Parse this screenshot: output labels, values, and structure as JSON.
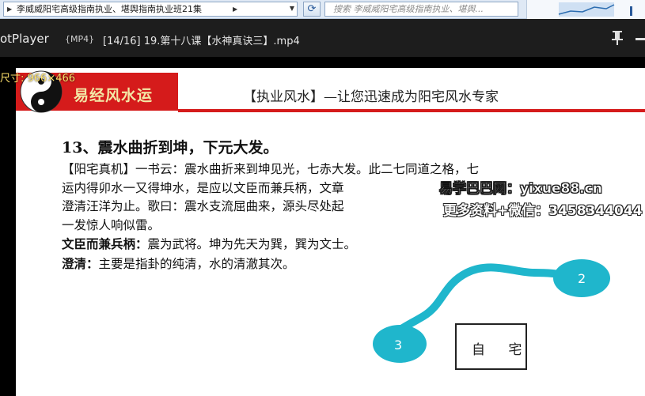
{
  "explorer": {
    "path_segments": [
      "李威威阳宅高级指南执业、堪舆指南执业班21集"
    ],
    "search_placeholder": "搜索 李威威阳宅高级指南执业、堪舆..."
  },
  "player": {
    "app_name": "otPlayer",
    "format": "{MP4}",
    "file_title": "[14/16] 19.第十八课【水神真诀三】.mp4"
  },
  "overlay": {
    "resolution_label": "尺寸: 966×466"
  },
  "slide": {
    "brand": "易经风水运",
    "tagline": "【执业风水】—让您迅速成为阳宅风水专家",
    "heading": "13、震水曲折到坤，下元大发。",
    "lines": [
      "【阳宅真机】一书云：震水曲折来到坤见光，七赤大发。此二七同道之格，七",
      "运内得卯水一又得坤水，是应以文臣而兼兵柄，文章",
      "澄清汪洋为止。歌曰：震水支流屈曲来，源头尽处起",
      "一发惊人响似雷。"
    ],
    "term1_label": "文臣而兼兵柄：",
    "term1_text": "震为武将。坤为先天为巽，巽为文士。",
    "term2_label": "澄清：",
    "term2_text": "主要是指卦的纯清，水的清澈其次。",
    "house_label": "自 宅",
    "node2": "2",
    "node3": "3"
  },
  "watermark": {
    "line1": "易学巴巴网：yixue88.cn",
    "line2": "更多资料+微信：3458344044"
  },
  "colors": {
    "brand_red": "#d51b1b",
    "river_blue": "#1fb6cc",
    "titlebar": "#1d1d1d"
  }
}
